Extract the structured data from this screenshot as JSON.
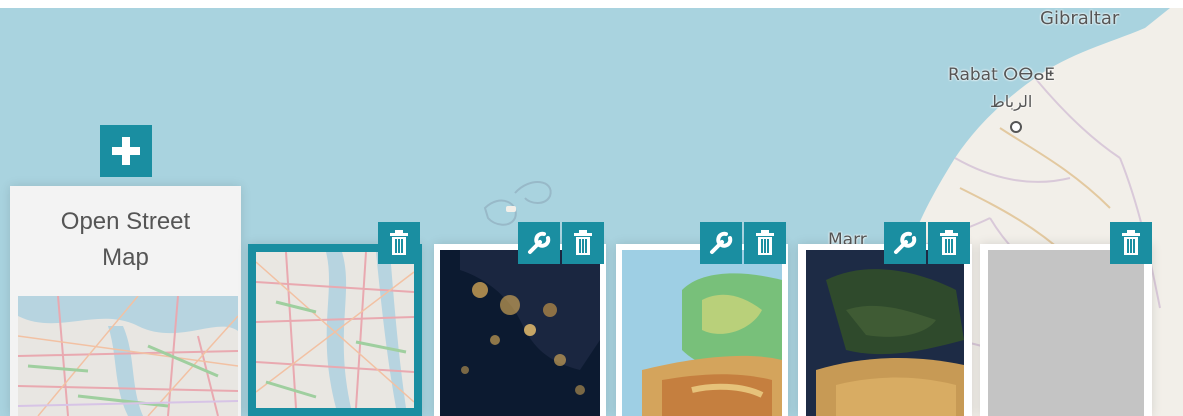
{
  "map": {
    "places": {
      "gibraltar": "Gibraltar",
      "rabat": "Rabat ⵔⴱⴰⵟ",
      "rabat_ar": "الرباط",
      "marrakesh": "Marr"
    },
    "colors": {
      "sea": "#a9d3df",
      "land": "#f2efe9",
      "accent": "#1a8ea1"
    }
  },
  "layers": {
    "add_icon": "plus-icon",
    "active": {
      "title": "Open Street Map",
      "thumbnail": "street-map"
    },
    "items": [
      {
        "thumbnail": "street-map",
        "selected": true,
        "actions": [
          "trash-icon"
        ]
      },
      {
        "thumbnail": "night-lights",
        "selected": false,
        "actions": [
          "wrench-icon",
          "trash-icon"
        ]
      },
      {
        "thumbnail": "terrain-relief",
        "selected": false,
        "actions": [
          "wrench-icon",
          "trash-icon"
        ]
      },
      {
        "thumbnail": "satellite",
        "selected": false,
        "actions": [
          "wrench-icon",
          "trash-icon"
        ]
      },
      {
        "thumbnail": "blank",
        "selected": false,
        "actions": [
          "trash-icon"
        ]
      }
    ]
  }
}
